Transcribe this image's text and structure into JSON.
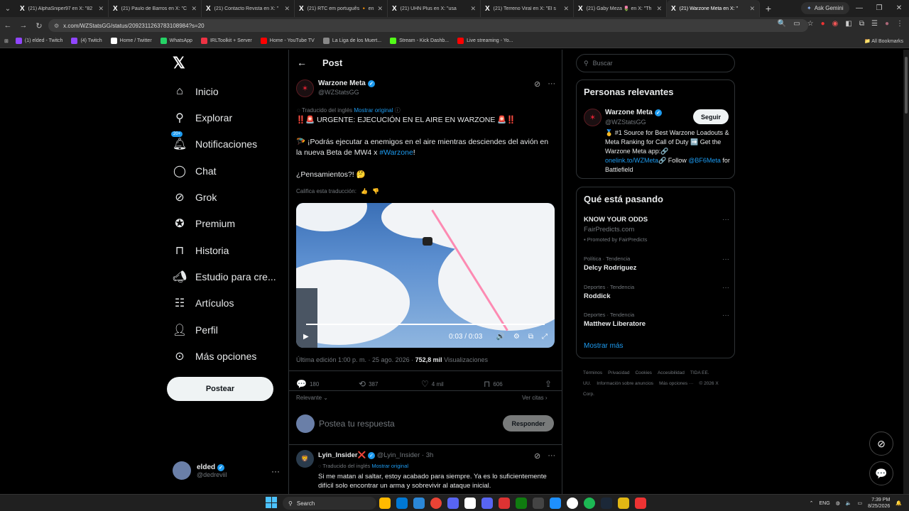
{
  "browser": {
    "tabs": [
      {
        "title": "(21) AlphaSniper97 en X: \"82",
        "active": false
      },
      {
        "title": "(21) Paulo de Barros en X: \"C",
        "active": false
      },
      {
        "title": "(21) Contacto Revista en X: \"",
        "active": false
      },
      {
        "title": "(21) RTC em português 🔸 en",
        "active": false
      },
      {
        "title": "(21) UHN Plus en X: \"usa",
        "active": false
      },
      {
        "title": "(21) Terreno Viral en X: \"El s",
        "active": false
      },
      {
        "title": "(21) Gaby Meza 🌷 en X: \"Th",
        "active": false
      },
      {
        "title": "(21) Warzone Meta en X: \"",
        "active": true
      }
    ],
    "ask_gemini": "Ask Gemini",
    "url": "x.com/WZStatsGG/status/2092311263783108984?s=20",
    "bookmarks": [
      {
        "label": "(1) elded - Twitch",
        "color": "#9146ff"
      },
      {
        "label": "(4) Twitch",
        "color": "#9146ff"
      },
      {
        "label": "Home / Twitter",
        "color": "#ffffff"
      },
      {
        "label": "WhatsApp",
        "color": "#25d366"
      },
      {
        "label": "IRLToolkit + Server",
        "color": "#e34"
      },
      {
        "label": "Home - YouTube TV",
        "color": "#f00"
      },
      {
        "label": "La Liga de los Muert...",
        "color": "#888"
      },
      {
        "label": "Stream - Kick Dashb...",
        "color": "#53fc18"
      },
      {
        "label": "Live streaming - Yo...",
        "color": "#f00"
      }
    ],
    "all_bookmarks": "All Bookmarks"
  },
  "nav": {
    "items": [
      {
        "label": "Inicio",
        "icon": "home-icon"
      },
      {
        "label": "Explorar",
        "icon": "search-icon"
      },
      {
        "label": "Notificaciones",
        "icon": "bell-icon",
        "badge": "20+"
      },
      {
        "label": "Chat",
        "icon": "chat-icon"
      },
      {
        "label": "Grok",
        "icon": "grok-icon"
      },
      {
        "label": "Premium",
        "icon": "premium-icon"
      },
      {
        "label": "Historia",
        "icon": "bookmark-icon"
      },
      {
        "label": "Estudio para cre...",
        "icon": "megaphone-icon"
      },
      {
        "label": "Artículos",
        "icon": "article-icon"
      },
      {
        "label": "Perfil",
        "icon": "person-icon"
      },
      {
        "label": "Más opciones",
        "icon": "more-icon"
      }
    ],
    "post_button": "Postear",
    "me": {
      "name": "elded",
      "handle": "@dedreviil"
    }
  },
  "post": {
    "header": "Post",
    "author": {
      "name": "Warzone Meta",
      "handle": "@WZStatsGG"
    },
    "translated_label": "Traducido del inglés",
    "show_original": "Mostrar original",
    "line1": "‼️🚨 URGENTE: EJECUCIÓN EN EL AIRE EN WARZONE 🚨‼️",
    "line2_pre": "🪂 ¡Podrás ejecutar a enemigos en el aire mientras desciendes del avión en la nueva Beta de MW4 x ",
    "hashtag": "#Warzone",
    "line2_post": "!",
    "line3": "¿Pensamientos?! 🤔",
    "rate_translation": "Califica esta traducción:",
    "video": {
      "time": "0:03 / 0:03",
      "progress": 1.0
    },
    "meta_prefix": "Última edición 1:00 p. m. · 25 ago. 2026 · ",
    "views": "752,8 mil",
    "views_label": " Visualizaciones",
    "stats": {
      "replies": "180",
      "reposts": "387",
      "likes": "4 mil",
      "bookmarks": "606"
    },
    "relevant": "Relevante",
    "quotes": "Ver citas",
    "reply_placeholder": "Postea tu respuesta",
    "reply_button": "Responder"
  },
  "reply": {
    "name": "Lyin_Insider",
    "emoji": "❌",
    "handle": "@Lyin_Insider · 3h",
    "translated_label": "Traducido del inglés",
    "show_original": "Mostrar original",
    "body": "Si me matan al saltar, estoy acabado para siempre. Ya es lo suficientemente difícil solo encontrar un arma y sobrevivir al ataque inicial."
  },
  "sidebar": {
    "search_placeholder": "Buscar",
    "relevant_title": "Personas relevantes",
    "rel": {
      "name": "Warzone Meta",
      "handle": "@WZStatsGG",
      "follow": "Seguir",
      "bio1": "🥇 #1 Source for Best Warzone Loadouts & Meta Ranking for Call of Duty ➡️ Get the Warzone Meta app:🔗 ",
      "bio_link": "onelink.to/WZMeta",
      "bio2": "🔗 Follow ",
      "bio_link2": "@BF6Meta",
      "bio3": " for Battlefield"
    },
    "trends_title": "Qué está pasando",
    "trends": [
      {
        "category": "",
        "name": "KNOW YOUR ODDS",
        "sub": "FairPredicts.com",
        "promo": "Promoted by FairPredicts"
      },
      {
        "category": "Política · Tendencia",
        "name": "Delcy Rodríguez"
      },
      {
        "category": "Deportes · Tendencia",
        "name": "Roddick"
      },
      {
        "category": "Deportes · Tendencia",
        "name": "Matthew Liberatore"
      }
    ],
    "show_more": "Mostrar más",
    "footer": [
      "Términos",
      "Privacidad",
      "Cookies",
      "Accesibilidad",
      "TIDA EE. UU.",
      "Información sobre anuncios",
      "Más opciones ···",
      "© 2026 X Corp."
    ]
  },
  "taskbar": {
    "search": "Search",
    "lang": "ENG",
    "time": "7:39 PM",
    "date": "8/25/2026"
  }
}
